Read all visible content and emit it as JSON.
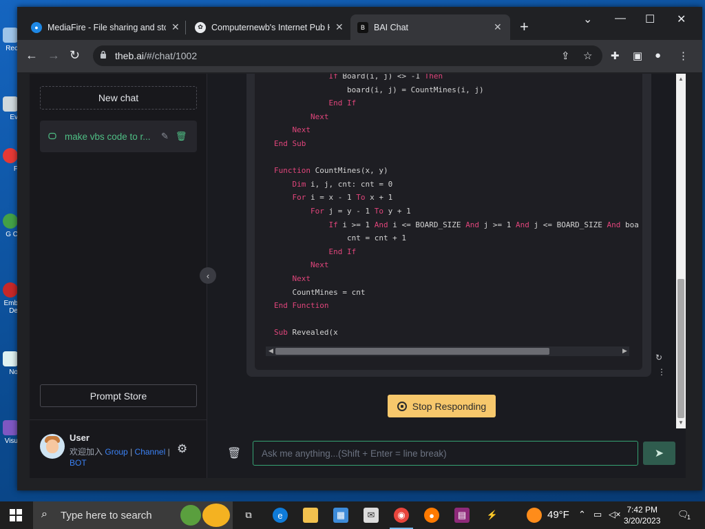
{
  "browser": {
    "tabs": [
      {
        "title": "MediaFire - File sharing and stor",
        "active": false
      },
      {
        "title": "Computernewb's Internet Pub H",
        "active": false
      },
      {
        "title": "BAI Chat",
        "active": true
      }
    ],
    "url_host": "theb.ai",
    "url_path": "/#/chat/1002"
  },
  "desktop": {
    "icons": [
      "Rec",
      "Ev",
      "F",
      "G C",
      "Emb De",
      "No",
      "Visu"
    ]
  },
  "sidebar": {
    "new_chat_label": "New chat",
    "chat_items": [
      {
        "label": "make vbs code to r..."
      }
    ],
    "prompt_store_label": "Prompt Store",
    "user": {
      "name": "User",
      "join_text": "欢迎加入",
      "link_group": "Group",
      "link_channel": "Channel",
      "link_bot": "BOT",
      "sep": "|"
    }
  },
  "code_lines": [
    [
      {
        "t": "            "
      },
      {
        "t": "If",
        "k": 1
      },
      {
        "t": " Board(i, j) <> -1 "
      },
      {
        "t": "Then",
        "k": 1
      }
    ],
    [
      {
        "t": "                board(i, j) = CountMines(i, j)"
      }
    ],
    [
      {
        "t": "            "
      },
      {
        "t": "End If",
        "k": 1
      }
    ],
    [
      {
        "t": "        "
      },
      {
        "t": "Next",
        "k": 1
      }
    ],
    [
      {
        "t": "    "
      },
      {
        "t": "Next",
        "k": 1
      }
    ],
    [
      {
        "t": "End Sub",
        "k": 1
      }
    ],
    [
      {
        "t": ""
      }
    ],
    [
      {
        "t": "Function",
        "k": 1
      },
      {
        "t": " CountMines(x, y)"
      }
    ],
    [
      {
        "t": "    "
      },
      {
        "t": "Dim",
        "k": 1
      },
      {
        "t": " i, j, cnt: cnt = 0"
      }
    ],
    [
      {
        "t": "    "
      },
      {
        "t": "For",
        "k": 1
      },
      {
        "t": " i = x - 1 "
      },
      {
        "t": "To",
        "k": 1
      },
      {
        "t": " x + 1"
      }
    ],
    [
      {
        "t": "        "
      },
      {
        "t": "For",
        "k": 1
      },
      {
        "t": " j = y - 1 "
      },
      {
        "t": "To",
        "k": 1
      },
      {
        "t": " y + 1"
      }
    ],
    [
      {
        "t": "            "
      },
      {
        "t": "If",
        "k": 1
      },
      {
        "t": " i >= 1 "
      },
      {
        "t": "And",
        "k": 1
      },
      {
        "t": " i <= BOARD_SIZE "
      },
      {
        "t": "And",
        "k": 1
      },
      {
        "t": " j >= 1 "
      },
      {
        "t": "And",
        "k": 1
      },
      {
        "t": " j <= BOARD_SIZE "
      },
      {
        "t": "And",
        "k": 1
      },
      {
        "t": " boa"
      }
    ],
    [
      {
        "t": "                cnt = cnt + 1"
      }
    ],
    [
      {
        "t": "            "
      },
      {
        "t": "End If",
        "k": 1
      }
    ],
    [
      {
        "t": "        "
      },
      {
        "t": "Next",
        "k": 1
      }
    ],
    [
      {
        "t": "    "
      },
      {
        "t": "Next",
        "k": 1
      }
    ],
    [
      {
        "t": "    CountMines = cnt"
      }
    ],
    [
      {
        "t": "End Function",
        "k": 1
      }
    ],
    [
      {
        "t": ""
      }
    ],
    [
      {
        "t": "Sub",
        "k": 1
      },
      {
        "t": " Revealed(x"
      }
    ]
  ],
  "stop_label": "Stop Responding",
  "input": {
    "placeholder": "Ask me anything...(Shift + Enter = line break)",
    "value": ""
  },
  "taskbar": {
    "search_placeholder": "Type here to search",
    "weather": "49°F",
    "time": "7:42 PM",
    "date": "3/20/2023",
    "notification_count": "1"
  },
  "colors": {
    "accent": "#36a374",
    "keyword": "#e0457b",
    "stop_button": "#f7c86c",
    "chat_label": "#4fbf85",
    "link": "#3b82f6"
  },
  "icons": [
    "edge-icon",
    "file-explorer-icon",
    "store-icon",
    "mail-icon",
    "chrome-icon",
    "firefox-icon",
    "winrar-icon",
    "kali-icon"
  ]
}
